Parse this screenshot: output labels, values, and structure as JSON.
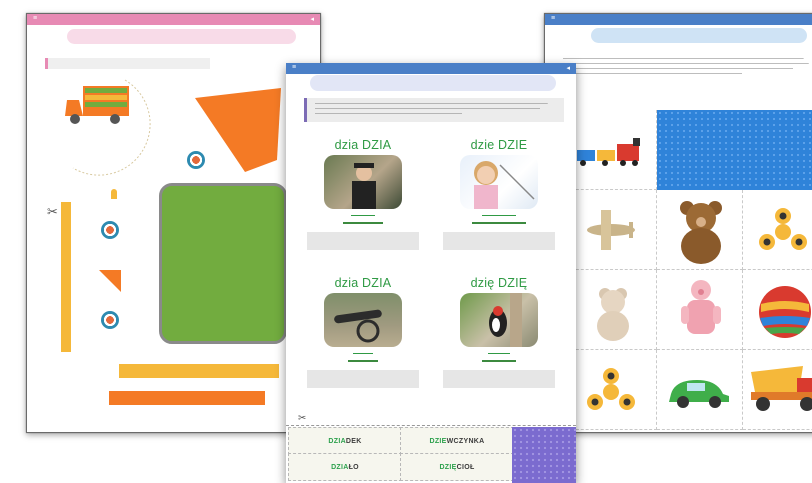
{
  "left_sheet": {
    "colors": {
      "bar": "#e78ab4",
      "pill": "#f8dbe8",
      "green_card": "#72ac3f",
      "orange": "#f47a25",
      "yellow": "#f5b83a"
    },
    "icons": [
      "scissors-icon",
      "truck-icon"
    ]
  },
  "middle_sheet": {
    "cells": [
      {
        "syllables": "dzia DZIA"
      },
      {
        "syllables": "dzie DZIE"
      },
      {
        "syllables": "dzia DZIA"
      },
      {
        "syllables": "dzię DZIĘ"
      }
    ],
    "cut_cards": [
      {
        "prefix": "DZIA",
        "rest": "DEK"
      },
      {
        "prefix": "DZIE",
        "rest": "WCZYNKA"
      },
      {
        "prefix": "DZIA",
        "rest": "ŁO"
      },
      {
        "prefix": "DZIĘ",
        "rest": "CIOŁ"
      }
    ],
    "colors": {
      "bar": "#4a7fc7",
      "green": "#2f9a44",
      "purple": "#7b6bcf"
    }
  },
  "right_sheet": {
    "colors": {
      "bar": "#4a7fc7",
      "blue_tile": "#2f83d9"
    },
    "toys": [
      "train-icon",
      "plane-icon",
      "teddy-bear-icon",
      "fidget-spinner-icon",
      "teddy-bear-icon",
      "pig-doll-icon",
      "ball-icon",
      "fidget-spinner-icon",
      "car-icon",
      "dump-truck-icon"
    ]
  }
}
